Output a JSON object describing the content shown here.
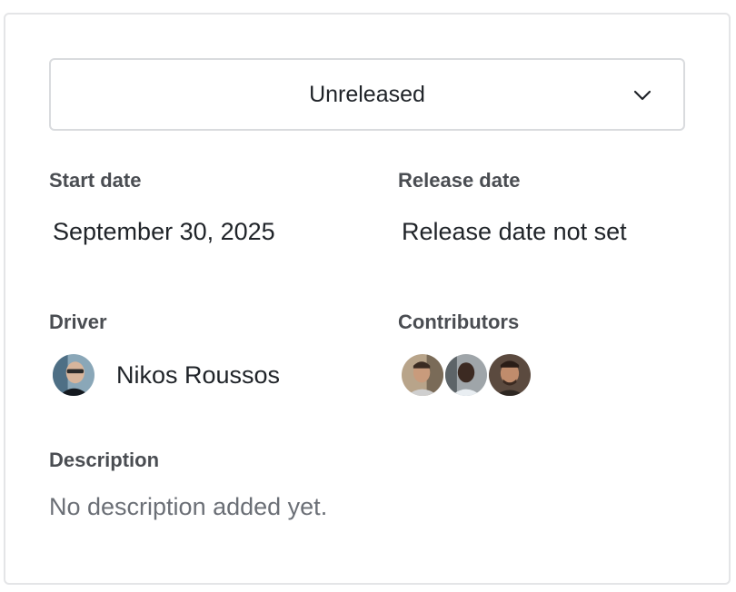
{
  "status": {
    "value": "Unreleased"
  },
  "start_date": {
    "label": "Start date",
    "value": "September 30, 2025"
  },
  "release_date": {
    "label": "Release date",
    "value": "Release date not set"
  },
  "driver": {
    "label": "Driver",
    "name": "Nikos Roussos"
  },
  "contributors": {
    "label": "Contributors"
  },
  "description": {
    "label": "Description",
    "value": "No description added yet."
  },
  "icons": {
    "status_chevron": "chevron-down-icon"
  }
}
